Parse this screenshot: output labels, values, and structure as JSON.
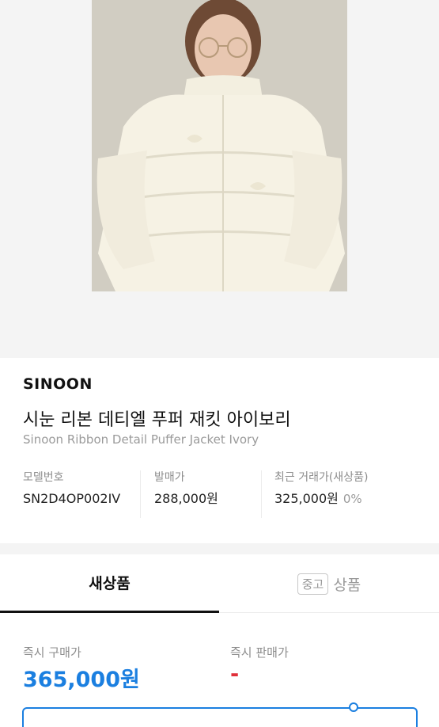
{
  "product": {
    "brand": "SINOON",
    "title_ko": "시눈 리본 데티엘 푸퍼 재킷 아이보리",
    "title_en": "Sinoon Ribbon Detail Puffer Jacket Ivory"
  },
  "meta": {
    "model_label": "모델번호",
    "model_value": "SN2D4OP002IV",
    "release_label": "발매가",
    "release_value": "288,000원",
    "recent_label": "최근 거래가(새상품)",
    "recent_value": "325,000원",
    "recent_change": "0%"
  },
  "tabs": {
    "new_label": "새상품",
    "used_badge": "중고",
    "used_label": "상품"
  },
  "prices": {
    "buy_label": "즉시 구매가",
    "buy_value": "365,000원",
    "sell_label": "즉시 판매가",
    "sell_value": "-"
  },
  "colors": {
    "accent_blue": "#1b7fe0",
    "sell_red": "#e0303a"
  }
}
